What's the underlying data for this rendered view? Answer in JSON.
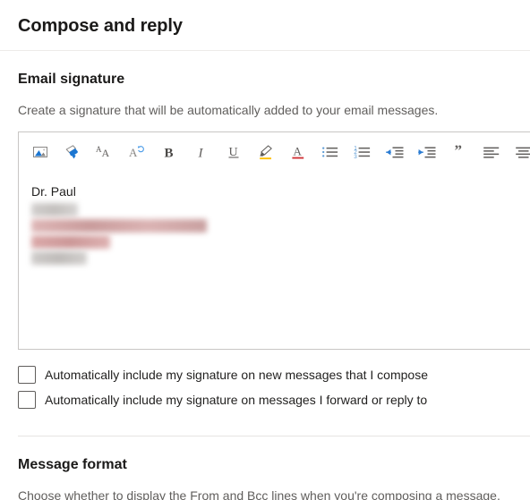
{
  "header": {
    "title": "Compose and reply"
  },
  "signature_section": {
    "title": "Email signature",
    "description": "Create a signature that will be automatically added to your email messages.",
    "editor": {
      "toolbar": [
        {
          "name": "insert-picture-icon",
          "label": "Insert picture"
        },
        {
          "name": "format-painter-icon",
          "label": "Format painter"
        },
        {
          "name": "font-icon",
          "label": "Font"
        },
        {
          "name": "clear-formatting-icon",
          "label": "Clear formatting"
        },
        {
          "name": "bold-icon",
          "label": "Bold"
        },
        {
          "name": "italic-icon",
          "label": "Italic"
        },
        {
          "name": "underline-icon",
          "label": "Underline"
        },
        {
          "name": "highlight-icon",
          "label": "Highlight"
        },
        {
          "name": "font-color-icon",
          "label": "Font color"
        },
        {
          "name": "bulleted-list-icon",
          "label": "Bulleted list"
        },
        {
          "name": "numbered-list-icon",
          "label": "Numbered list"
        },
        {
          "name": "decrease-indent-icon",
          "label": "Decrease indent"
        },
        {
          "name": "increase-indent-icon",
          "label": "Increase indent"
        },
        {
          "name": "quote-icon",
          "label": "Quote"
        },
        {
          "name": "align-left-icon",
          "label": "Align left"
        },
        {
          "name": "align-center-icon",
          "label": "Align center"
        }
      ],
      "content": {
        "name_line": "Dr. Paul",
        "redacted_lines": 4
      }
    },
    "checkboxes": [
      {
        "label": "Automatically include my signature on new messages that I compose",
        "checked": false
      },
      {
        "label": "Automatically include my signature on messages I forward or reply to",
        "checked": false
      }
    ]
  },
  "message_format_section": {
    "title": "Message format",
    "description": "Choose whether to display the From and Bcc lines when you're composing a message."
  },
  "colors": {
    "accent_blue": "#0078d4",
    "highlight_yellow": "#ffc000",
    "font_color_red": "#d13438",
    "text_primary": "#201f1e",
    "text_secondary": "#605e5c",
    "border": "#c8c6c4",
    "divider": "#edebe9"
  }
}
